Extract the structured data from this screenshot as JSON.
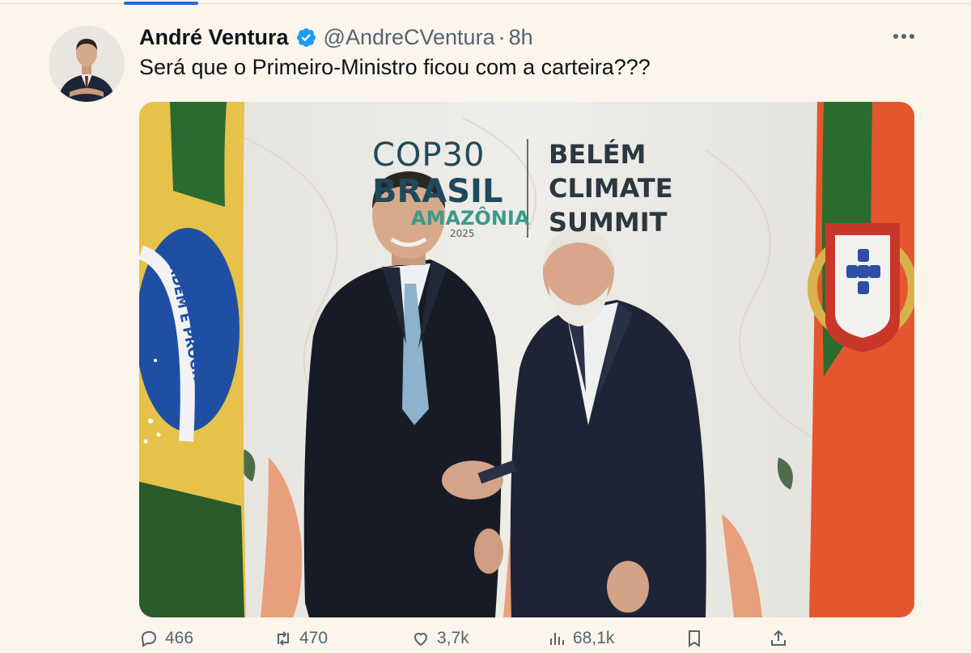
{
  "tweet": {
    "author": {
      "display_name": "André Ventura",
      "verified_icon": "verified-badge-icon",
      "handle": "@AndreCVentura",
      "separator": "·",
      "time": "8h"
    },
    "more_icon": "more-options-icon",
    "text": "Será que o Primeiro-Ministro ficou com a carteira???",
    "media": {
      "cop_logo_line1": "COP30",
      "cop_logo_line2": "BRASIL",
      "cop_logo_line3": "AMAZÔNIA",
      "cop_logo_year": "2025",
      "summit_line1": "BELÉM",
      "summit_line2": "CLIMATE",
      "summit_line3": "SUMMIT",
      "flag_motto": "ORDEM E PROGRESSO"
    },
    "actions": {
      "replies": {
        "icon": "reply-icon",
        "count": "466"
      },
      "reposts": {
        "icon": "repost-icon",
        "count": "470"
      },
      "likes": {
        "icon": "like-icon",
        "count": "3,7k"
      },
      "views": {
        "icon": "views-icon",
        "count": "68,1k"
      },
      "bookmark": {
        "icon": "bookmark-icon"
      },
      "share": {
        "icon": "share-icon"
      }
    },
    "colors": {
      "verified": "#1d9bf0",
      "text": "#0f1419",
      "muted": "#536471",
      "background": "#fbf5ec"
    }
  }
}
